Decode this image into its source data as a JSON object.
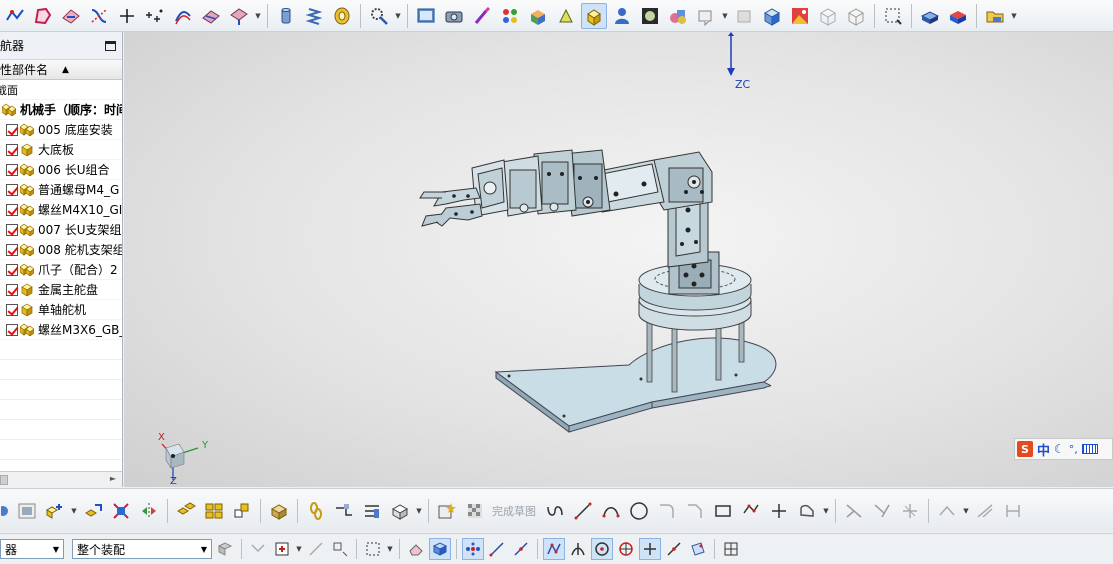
{
  "toolbar_top": {
    "icons": [
      "curve-icon",
      "sketch-icon",
      "face-icon",
      "intersection-curve-icon",
      "plus-point-icon",
      "point-set-icon",
      "offset-curve-icon",
      "bridge-surface-icon",
      "extend-surface-icon",
      "cylinder-icon",
      "spring-icon",
      "tire-icon",
      "gear-tool-icon",
      "view-screen-icon",
      "camera-icon",
      "paint-brush-icon",
      "color-dots-icon",
      "shaded-faces-icon",
      "highlight-icon",
      "selected-part-icon",
      "person-icon",
      "studio-render-icon",
      "shapes-icon",
      "edit-object-icon",
      "cube-grey-icon",
      "cube-blue-icon",
      "image-render-icon",
      "wireframe-cube-icon",
      "wireframe-box-icon",
      "selection-rect-icon",
      "shaded-model-icon",
      "blue-model-icon",
      "folder-load-icon"
    ],
    "active_icon": "selected-part-icon"
  },
  "navigator": {
    "title": "导航器",
    "column_header": "描述性部件名",
    "section_row": "截面",
    "root_item": "机械手（顺序：时间",
    "items": [
      {
        "label": "005 底座安装",
        "type": "assembly"
      },
      {
        "label": "大底板",
        "type": "part"
      },
      {
        "label": "006 长U组合",
        "type": "assembly"
      },
      {
        "label": "普通螺母M4_G",
        "type": "assembly"
      },
      {
        "label": "螺丝M4X10_GI",
        "type": "assembly"
      },
      {
        "label": "007 长U支架组",
        "type": "assembly"
      },
      {
        "label": "008 舵机支架组",
        "type": "assembly"
      },
      {
        "label": "爪子（配合）2",
        "type": "assembly"
      },
      {
        "label": "金属主舵盘",
        "type": "part"
      },
      {
        "label": "单轴舵机",
        "type": "part"
      },
      {
        "label": "螺丝M3X6_GB_",
        "type": "assembly"
      }
    ]
  },
  "viewport": {
    "zc_label": "ZC",
    "triad": {
      "x": "X",
      "y": "Y",
      "z": "Z"
    }
  },
  "ime_bar": {
    "s_label": "S",
    "mode": "中",
    "moon": "☾",
    "punct": "°,"
  },
  "bottom_toolbar": {
    "sketch_done_label": "完成草图"
  },
  "selection_bar": {
    "filter_value": "器",
    "scope_value": "整个装配"
  }
}
